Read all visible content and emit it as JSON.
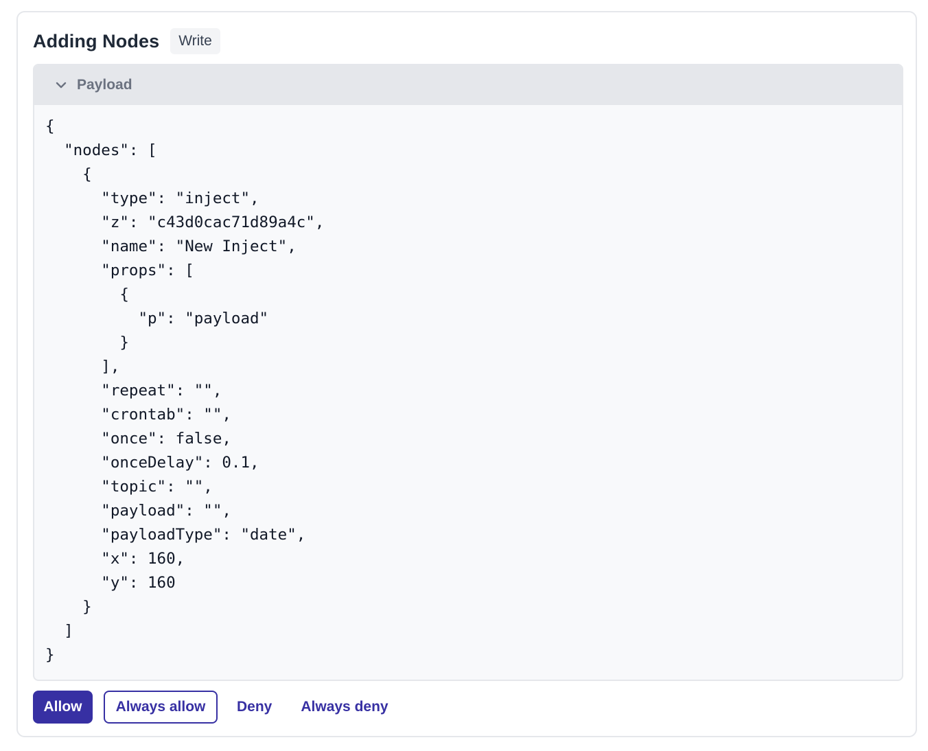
{
  "header": {
    "title": "Adding Nodes",
    "badge": "Write"
  },
  "payload": {
    "label": "Payload",
    "expanded": true,
    "code": "{\n  \"nodes\": [\n    {\n      \"type\": \"inject\",\n      \"z\": \"c43d0cac71d89a4c\",\n      \"name\": \"New Inject\",\n      \"props\": [\n        {\n          \"p\": \"payload\"\n        }\n      ],\n      \"repeat\": \"\",\n      \"crontab\": \"\",\n      \"once\": false,\n      \"onceDelay\": 0.1,\n      \"topic\": \"\",\n      \"payload\": \"\",\n      \"payloadType\": \"date\",\n      \"x\": 160,\n      \"y\": 160\n    }\n  ]\n}"
  },
  "actions": {
    "allow": "Allow",
    "always_allow": "Always allow",
    "deny": "Deny",
    "always_deny": "Always deny"
  },
  "colors": {
    "accent": "#3730a3",
    "panel_header": "#e5e7eb",
    "code_background": "#f8f9fb",
    "badge_background": "#f3f4f6"
  },
  "icons": {
    "collapse": "chevron-down-icon"
  }
}
